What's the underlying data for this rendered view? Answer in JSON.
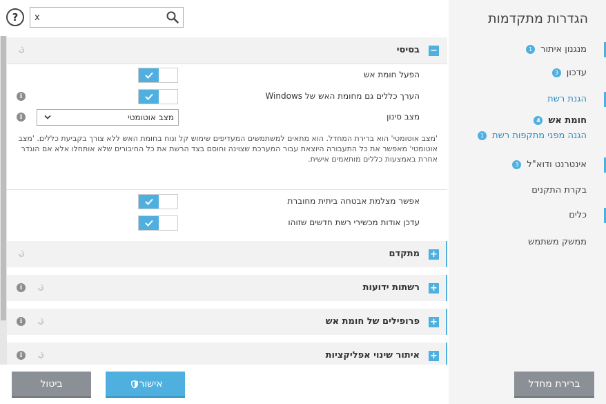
{
  "nav": {
    "title": "הגדרות מתקדמות",
    "items": [
      {
        "label": "מנגנון איתור",
        "badge": "1"
      },
      {
        "label": "עדכון",
        "badge": "3"
      },
      {
        "label": "הגנת רשת",
        "badge": ""
      },
      {
        "label": "חומת אש",
        "badge": "4"
      },
      {
        "label": "הגנה מפני מתקפות רשת",
        "badge": "1"
      },
      {
        "label": "אינטרנט ודוא\"ל",
        "badge": "3"
      },
      {
        "label": "בקרת התקנים",
        "badge": ""
      },
      {
        "label": "כלים",
        "badge": ""
      },
      {
        "label": "ממשק משתמש",
        "badge": ""
      }
    ]
  },
  "search": {
    "value": "x",
    "placeholder": ""
  },
  "help": {
    "label": "?"
  },
  "sections": {
    "basic": {
      "title": "בסיסי",
      "expander": "−"
    },
    "advanced": {
      "title": "מתקדם",
      "expander": "+"
    },
    "known_networks": {
      "title": "רשתות ידועות",
      "expander": "+"
    },
    "profiles": {
      "title": "פרופילים של חומת אש",
      "expander": "+"
    },
    "app_change": {
      "title": "איתור שינוי אפליקציות",
      "expander": "+"
    }
  },
  "settings": {
    "enable_firewall": {
      "label": "הפעל חומת אש",
      "on": true
    },
    "eval_windows_rules": {
      "label": "הערך כללים גם מחומת האש של Windows",
      "on": true
    },
    "filter_mode": {
      "label": "מצב סינון",
      "value": "מצב אוטומטי"
    },
    "description": "'מצב אוטומטי' הוא ברירת המחדל. הוא מתאים למשתמשים המעדיפים שימוש קל ונוח בחומת האש ללא צורך בקביעת כללים. 'מצב אוטומטי' מאפשר את כל התעבורה היוצאת עבור המערכת שצוינה וחוסם בצד הרשת את כל החיבורים שלא אותחלו אלא אם הוגדר אחרת באמצעות כללים מותאמים אישית.",
    "home_network_protection": {
      "label": "אפשר מצלמת אבטחה ביתית מחוברת",
      "on": true
    },
    "notify_new_devices": {
      "label": "עדכן אודות מכשירי רשת חדשים שזוהו",
      "on": true
    }
  },
  "buttons": {
    "cancel": "ביטול",
    "ok": "אישור",
    "default": "ברירת מחדל"
  },
  "colors": {
    "accent": "#4fb0e0",
    "button_gray": "#8a9096"
  }
}
